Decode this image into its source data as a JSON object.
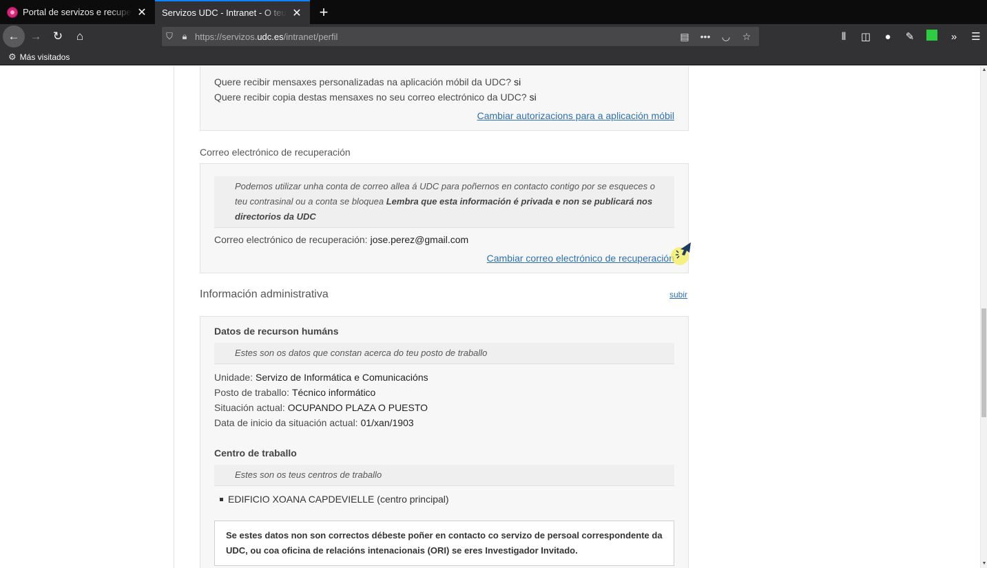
{
  "browser": {
    "tabs": [
      {
        "title": "Portal de servizos e recuperación",
        "active": false
      },
      {
        "title": "Servizos UDC - Intranet - O teu perfil",
        "active": true
      }
    ],
    "url_prefix": "https://servizos.",
    "url_domain": "udc.es",
    "url_path": "/intranet/perfil",
    "bookmark": "Más visitados"
  },
  "mobile": {
    "q1_label": "Quere recibir mensaxes personalizadas na aplicación móbil da UDC?",
    "q1_value": "si",
    "q2_label": "Quere recibir copia destas mensaxes no seu correo electrónico da UDC?",
    "q2_value": "si",
    "link": "Cambiar autorizacions para a aplicación móbil"
  },
  "recovery": {
    "title": "Correo electrónico de recuperación",
    "note_text": "Podemos utilizar unha conta de correo allea á UDC para poñernos en contacto contigo por se esqueces o teu contrasinal ou a conta se bloquea",
    "note_bold": "Lembra que esta información é privada e non se publicará nos directorios da UDC",
    "label": "Correo electrónico de recuperación:",
    "value": "jose.perez@gmail.com",
    "link": "Cambiar correo electrónico de recuperación"
  },
  "admin": {
    "title": "Información administrativa",
    "up_link": "subir",
    "hr_title": "Datos de recurson humáns",
    "hr_note": "Estes son os datos que constan acerca do teu posto de traballo",
    "unit_label": "Unidade:",
    "unit_value": "Servizo de Informática e Comunicacións",
    "post_label": "Posto de traballo:",
    "post_value": "Técnico informático",
    "status_label": "Situación actual:",
    "status_value": "OCUPANDO PLAZA O PUESTO",
    "start_label": "Data de inicio da situación actual:",
    "start_value": "01/xan/1903",
    "centre_title": "Centro de traballo",
    "centre_note": "Estes son os teus centros de traballo",
    "centre_item": "EDIFICIO XOANA CAPDEVIELLE (centro principal)",
    "warning": "Se estes datos non son correctos débeste poñer en contacto co servizo de persoal correspondente da UDC, ou coa oficina de relacións intenacionais (ORI) se eres Investigador Invitado."
  }
}
